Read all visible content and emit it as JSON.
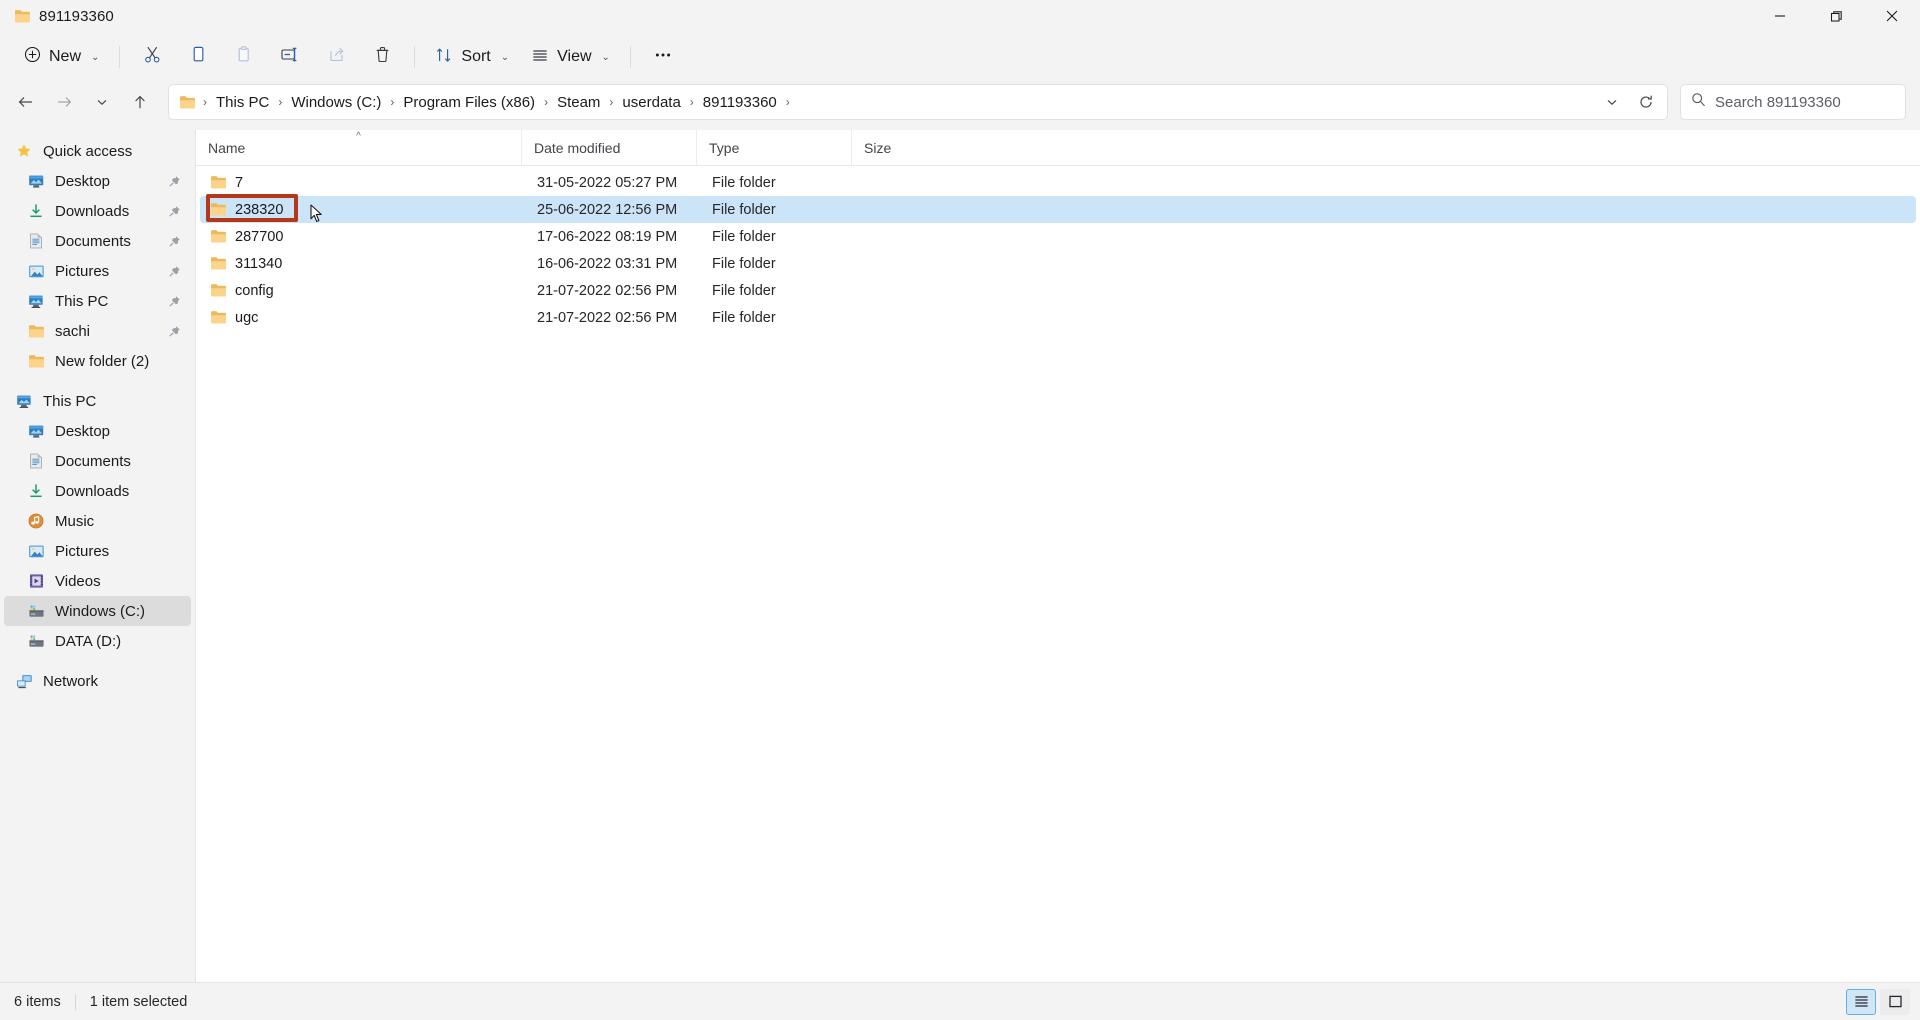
{
  "window": {
    "title": "891193360",
    "title_icon": "folder-icon",
    "controls": {
      "minimize": "minimize-icon",
      "restore": "restore-icon",
      "close": "close-icon"
    }
  },
  "commandbar": {
    "new_label": "New",
    "new_icon": "plus-circle-icon",
    "items": [
      {
        "name": "cut",
        "icon": "scissors-icon",
        "label": "Cut",
        "enabled": true
      },
      {
        "name": "copy",
        "icon": "copy-icon",
        "label": "Copy",
        "enabled": true
      },
      {
        "name": "paste",
        "icon": "paste-icon",
        "label": "Paste",
        "enabled": false
      },
      {
        "name": "rename",
        "icon": "rename-icon",
        "label": "Rename",
        "enabled": true
      },
      {
        "name": "share",
        "icon": "share-icon",
        "label": "Share",
        "enabled": false
      },
      {
        "name": "delete",
        "icon": "trash-icon",
        "label": "Delete",
        "enabled": true
      }
    ],
    "sort_label": "Sort",
    "sort_icon": "sort-arrows-icon",
    "view_label": "View",
    "view_icon": "view-lines-icon",
    "more_label": "...",
    "more_icon": "ellipsis-icon"
  },
  "navigation": {
    "back_icon": "arrow-left-icon",
    "forward_icon": "arrow-right-icon",
    "recent_icon": "chevron-down-icon",
    "up_icon": "arrow-up-icon",
    "breadcrumb": [
      "This PC",
      "Windows (C:)",
      "Program Files (x86)",
      "Steam",
      "userdata",
      "891193360"
    ],
    "breadcrumb_separator": "›",
    "address_dropdown_icon": "chevron-down-icon",
    "refresh_icon": "refresh-icon"
  },
  "search": {
    "icon": "search-icon",
    "placeholder": "Search 891193360",
    "value": ""
  },
  "sidebar": {
    "sections": [
      {
        "header": {
          "label": "Quick access",
          "icon": "star-icon"
        },
        "items": [
          {
            "label": "Desktop",
            "icon": "desktop-icon",
            "pinned": true
          },
          {
            "label": "Downloads",
            "icon": "download-icon",
            "pinned": true
          },
          {
            "label": "Documents",
            "icon": "document-icon",
            "pinned": true
          },
          {
            "label": "Pictures",
            "icon": "pictures-icon",
            "pinned": true
          },
          {
            "label": "This PC",
            "icon": "pc-icon",
            "pinned": true
          },
          {
            "label": "sachi",
            "icon": "folder-icon",
            "pinned": true
          },
          {
            "label": "New folder (2)",
            "icon": "folder-icon",
            "pinned": false
          }
        ]
      },
      {
        "header": {
          "label": "This PC",
          "icon": "pc-icon"
        },
        "items": [
          {
            "label": "Desktop",
            "icon": "desktop-icon",
            "pinned": false
          },
          {
            "label": "Documents",
            "icon": "document-icon",
            "pinned": false
          },
          {
            "label": "Downloads",
            "icon": "download-icon",
            "pinned": false
          },
          {
            "label": "Music",
            "icon": "music-icon",
            "pinned": false
          },
          {
            "label": "Pictures",
            "icon": "pictures-icon",
            "pinned": false
          },
          {
            "label": "Videos",
            "icon": "video-icon",
            "pinned": false
          },
          {
            "label": "Windows (C:)",
            "icon": "drive-icon",
            "pinned": false,
            "selected": true
          },
          {
            "label": "DATA (D:)",
            "icon": "drive-icon",
            "pinned": false
          }
        ]
      },
      {
        "header": {
          "label": "Network",
          "icon": "network-icon"
        },
        "items": []
      }
    ]
  },
  "filelist": {
    "columns": [
      {
        "key": "name",
        "label": "Name",
        "sorted": "ascending",
        "sort_icon": "caret-up-icon"
      },
      {
        "key": "date",
        "label": "Date modified"
      },
      {
        "key": "type",
        "label": "Type"
      },
      {
        "key": "size",
        "label": "Size"
      }
    ],
    "rows": [
      {
        "icon": "folder-icon",
        "name": "7",
        "date": "31-05-2022 05:27 PM",
        "type": "File folder",
        "size": "",
        "selected": false
      },
      {
        "icon": "folder-icon",
        "name": "238320",
        "date": "25-06-2022 12:56 PM",
        "type": "File folder",
        "size": "",
        "selected": true,
        "annotated": true
      },
      {
        "icon": "folder-icon",
        "name": "287700",
        "date": "17-06-2022 08:19 PM",
        "type": "File folder",
        "size": "",
        "selected": false
      },
      {
        "icon": "folder-icon",
        "name": "311340",
        "date": "16-06-2022 03:31 PM",
        "type": "File folder",
        "size": "",
        "selected": false
      },
      {
        "icon": "folder-icon",
        "name": "config",
        "date": "21-07-2022 02:56 PM",
        "type": "File folder",
        "size": "",
        "selected": false
      },
      {
        "icon": "folder-icon",
        "name": "ugc",
        "date": "21-07-2022 02:56 PM",
        "type": "File folder",
        "size": "",
        "selected": false
      }
    ]
  },
  "statusbar": {
    "item_count": "6 items",
    "selection_count": "1 item selected",
    "view_details_icon": "details-view-icon",
    "view_large_icon": "large-icons-view-icon"
  },
  "colors": {
    "accent_selection": "#cce4f7",
    "annotation_box": "#b3381a",
    "window_bg": "#f3f3f3",
    "content_bg": "#ffffff",
    "sidebar_selected": "#dcdcdc",
    "folder_yellow": "#f6c969"
  }
}
